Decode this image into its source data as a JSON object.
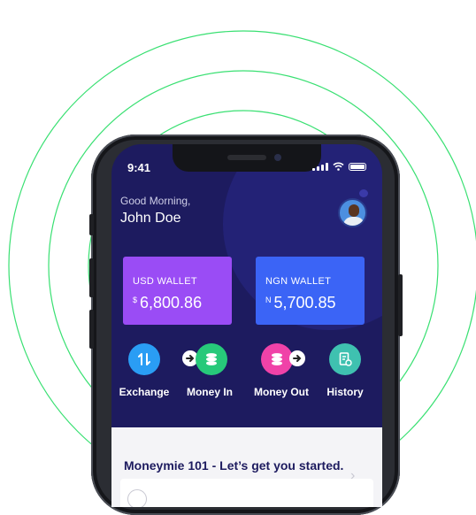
{
  "status_bar": {
    "time": "9:41"
  },
  "header": {
    "greeting": "Good Morning,",
    "username": "John Doe"
  },
  "wallets": [
    {
      "label": "USD WALLET",
      "currency_symbol": "$",
      "amount": "6,800.86",
      "color": "#9a4cf5"
    },
    {
      "label": "NGN WALLET",
      "currency_symbol": "N",
      "amount": "5,700.85",
      "color": "#3b64f6"
    }
  ],
  "actions": [
    {
      "label": "Exchange",
      "icon": "exchange-icon",
      "color": "#2a9df4"
    },
    {
      "label": "Money In",
      "icon": "coins-in-icon",
      "color": "#27c97a"
    },
    {
      "label": "Money Out",
      "icon": "coins-out-icon",
      "color": "#f042a8"
    },
    {
      "label": "History",
      "icon": "history-receipt-icon",
      "color": "#3fc1b0"
    }
  ],
  "sheet": {
    "title": "Moneymie 101 - Let’s get you started."
  },
  "colors": {
    "background": "#1d1b5f",
    "rings": "#39e072"
  }
}
